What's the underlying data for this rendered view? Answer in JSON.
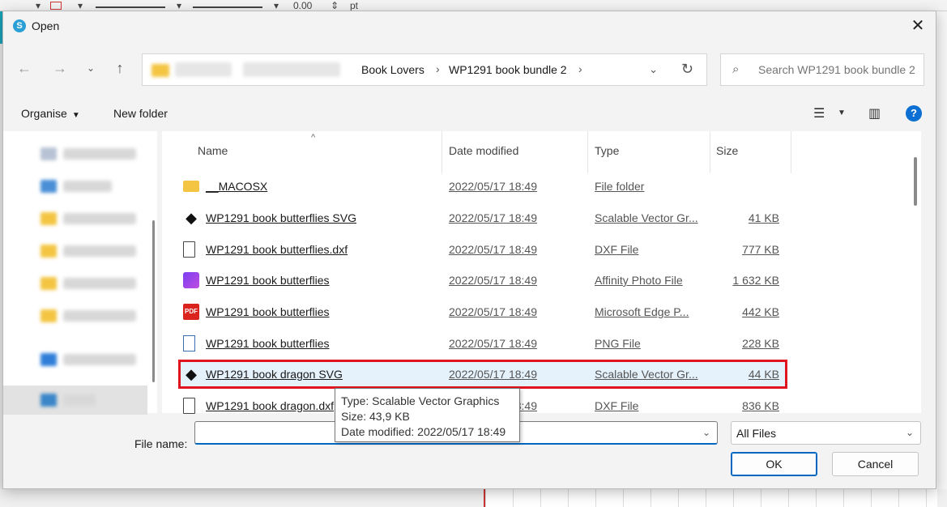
{
  "background": {
    "toolbar_value": "0.00",
    "toolbar_unit": "pt"
  },
  "dialog": {
    "title": "Open",
    "close_icon": "close-icon"
  },
  "address": {
    "crumbs": [
      "Book Lovers",
      "WP1291 book bundle 2"
    ],
    "separator": "›"
  },
  "search": {
    "placeholder": "Search WP1291 book bundle 2"
  },
  "commands": {
    "organise": "Organise",
    "new_folder": "New folder"
  },
  "columns": {
    "name": "Name",
    "date": "Date modified",
    "type": "Type",
    "size": "Size"
  },
  "files": [
    {
      "icon": "folder-icon",
      "name": "__MACOSX",
      "date": "2022/05/17 18:49",
      "type": "File folder",
      "size": ""
    },
    {
      "icon": "inkscape-svg-icon",
      "name": "WP1291 book butterflies SVG",
      "date": "2022/05/17 18:49",
      "type": "Scalable Vector Gr...",
      "size": "41 KB"
    },
    {
      "icon": "document-icon",
      "name": "WP1291 book butterflies.dxf",
      "date": "2022/05/17 18:49",
      "type": "DXF File",
      "size": "777 KB"
    },
    {
      "icon": "affinity-photo-icon",
      "name": "WP1291 book butterflies",
      "date": "2022/05/17 18:49",
      "type": "Affinity Photo File",
      "size": "1 632 KB"
    },
    {
      "icon": "pdf-icon",
      "name": "WP1291 book butterflies",
      "date": "2022/05/17 18:49",
      "type": "Microsoft Edge P...",
      "size": "442 KB"
    },
    {
      "icon": "png-image-icon",
      "name": "WP1291 book butterflies",
      "date": "2022/05/17 18:49",
      "type": "PNG File",
      "size": "228 KB"
    },
    {
      "icon": "inkscape-svg-icon",
      "name": "WP1291 book dragon SVG",
      "date": "2022/05/17 18:49",
      "type": "Scalable Vector Gr...",
      "size": "44 KB"
    },
    {
      "icon": "document-icon",
      "name": "WP1291 book dragon.dxf",
      "date": "2022/05/17 18:49",
      "type": "DXF File",
      "size": "836 KB"
    }
  ],
  "tooltip": {
    "line1": "Type: Scalable Vector Graphics",
    "line2": "Size: 43,9 KB",
    "line3": "Date modified: 2022/05/17 18:49"
  },
  "bottom": {
    "file_name_label": "File name:",
    "file_name_value": "",
    "filter": "All Files",
    "ok": "OK",
    "cancel": "Cancel"
  },
  "colors": {
    "highlight_border": "#e0141f",
    "accent": "#0067c0"
  }
}
